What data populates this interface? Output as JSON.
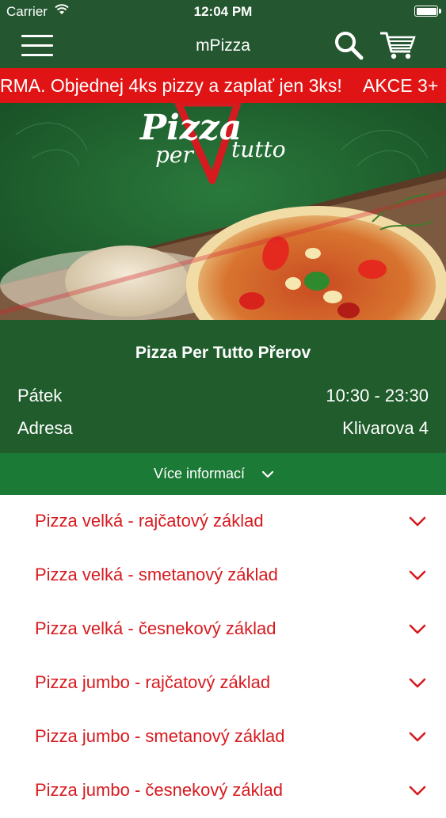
{
  "status_bar": {
    "carrier": "Carrier",
    "time": "12:04 PM"
  },
  "nav": {
    "title": "mPizza"
  },
  "ticker": {
    "text_main": "RMA. Objednej 4ks pizzy a zaplať jen 3ks!",
    "text_next": "AKCE 3+"
  },
  "hero": {
    "logo_line1": "Pizza",
    "logo_line2a": "per",
    "logo_line2b": "tutto"
  },
  "restaurant": {
    "name": "Pizza Per Tutto Přerov",
    "day_label": "Pátek",
    "hours": "10:30 - 23:30",
    "address_label": "Adresa",
    "address": "Klivarova 4"
  },
  "more_info": {
    "label": "Více informací"
  },
  "categories": [
    {
      "label": "Pizza velká - rajčatový základ"
    },
    {
      "label": "Pizza velká - smetanový základ"
    },
    {
      "label": "Pizza velká - česnekový základ"
    },
    {
      "label": "Pizza jumbo - rajčatový základ"
    },
    {
      "label": "Pizza jumbo - smetanový základ"
    },
    {
      "label": "Pizza jumbo - česnekový základ"
    }
  ],
  "colors": {
    "header_green": "#245730",
    "ticker_red": "#e01414",
    "accent_red": "#d71a1f",
    "info_green": "#205c2c",
    "more_green": "#1b7a36"
  },
  "icons": {
    "menu": "hamburger-icon",
    "search": "search-icon",
    "cart": "cart-icon",
    "expand": "chevron-down-icon"
  }
}
